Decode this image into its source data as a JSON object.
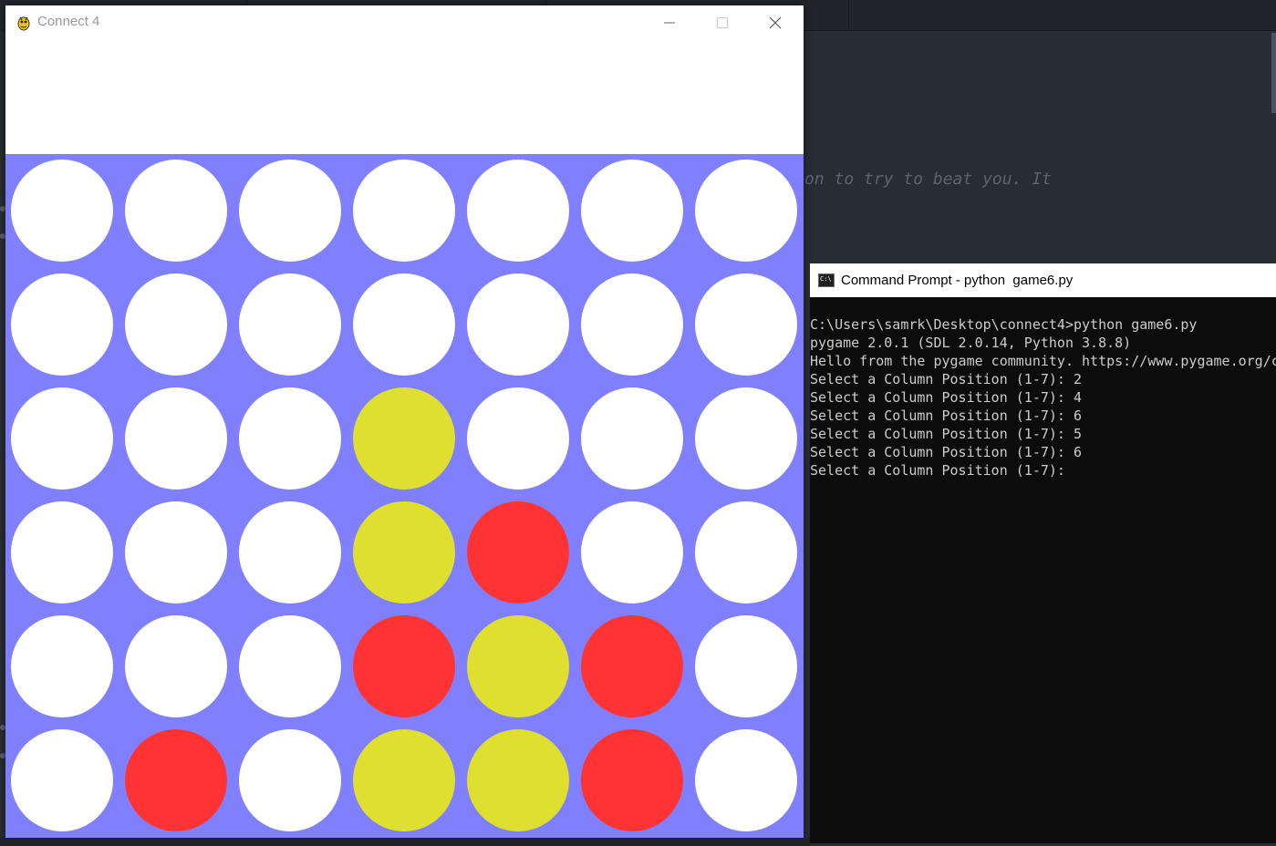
{
  "editor": {
    "code_line": "on to try to beat you. It"
  },
  "game_window": {
    "title": "Connect 4",
    "icon": "pygame-snake-icon",
    "controls": {
      "minimize": "minimize-icon",
      "maximize": "maximize-icon",
      "close": "close-icon"
    },
    "colors": {
      "board": "#8080ff",
      "empty": "#ffffff",
      "yellow": "#dfdf30",
      "red": "#ff3333"
    },
    "board": {
      "rows": 6,
      "cols": 7,
      "cells": [
        [
          "empty",
          "empty",
          "empty",
          "empty",
          "empty",
          "empty",
          "empty"
        ],
        [
          "empty",
          "empty",
          "empty",
          "empty",
          "empty",
          "empty",
          "empty"
        ],
        [
          "empty",
          "empty",
          "empty",
          "yellow",
          "empty",
          "empty",
          "empty"
        ],
        [
          "empty",
          "empty",
          "empty",
          "yellow",
          "red",
          "empty",
          "empty"
        ],
        [
          "empty",
          "empty",
          "empty",
          "red",
          "yellow",
          "red",
          "empty"
        ],
        [
          "empty",
          "red",
          "empty",
          "yellow",
          "yellow",
          "red",
          "empty"
        ]
      ]
    }
  },
  "cmd_window": {
    "title": "Command Prompt - python  game6.py",
    "icon_text": "C:\\",
    "lines": [
      "C:\\Users\\samrk\\Desktop\\connect4>python game6.py",
      "pygame 2.0.1 (SDL 2.0.14, Python 3.8.8)",
      "Hello from the pygame community. https://www.pygame.org/c",
      "Select a Column Position (1-7): 2",
      "Select a Column Position (1-7): 4",
      "Select a Column Position (1-7): 6",
      "Select a Column Position (1-7): 5",
      "Select a Column Position (1-7): 6",
      "Select a Column Position (1-7): "
    ]
  }
}
